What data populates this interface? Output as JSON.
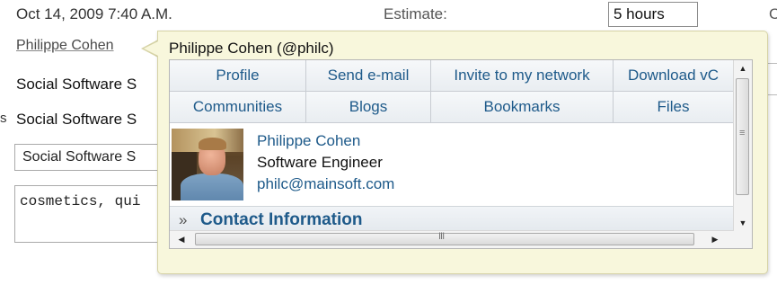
{
  "background": {
    "date": "Oct 14, 2009 7:40 A.M.",
    "estimate_label": "Estimate:",
    "estimate_value": "5 hours",
    "edge_char": "C",
    "person_link": "Philippe Cohen",
    "field1_text": "Social Software S",
    "field2_text": "Social Software S",
    "field2_marker": "s",
    "select_value": "Social Software S",
    "tags_value": "cosmetics, qui"
  },
  "card": {
    "title": "Philippe Cohen (@philc)",
    "actions": [
      "Profile",
      "Send e-mail",
      "Invite to my network",
      "Download vC",
      "Communities",
      "Blogs",
      "Bookmarks",
      "Files"
    ],
    "profile": {
      "name": "Philippe Cohen",
      "job_title": "Software Engineer",
      "email": "philc@mainsoft.com"
    },
    "contact": {
      "chevron": "»",
      "label": "Contact Information"
    },
    "scrollbar": {
      "up": "▲",
      "down": "▼",
      "left": "◀",
      "right": "▶",
      "grip_v": "≡",
      "grip_h": "III"
    }
  }
}
